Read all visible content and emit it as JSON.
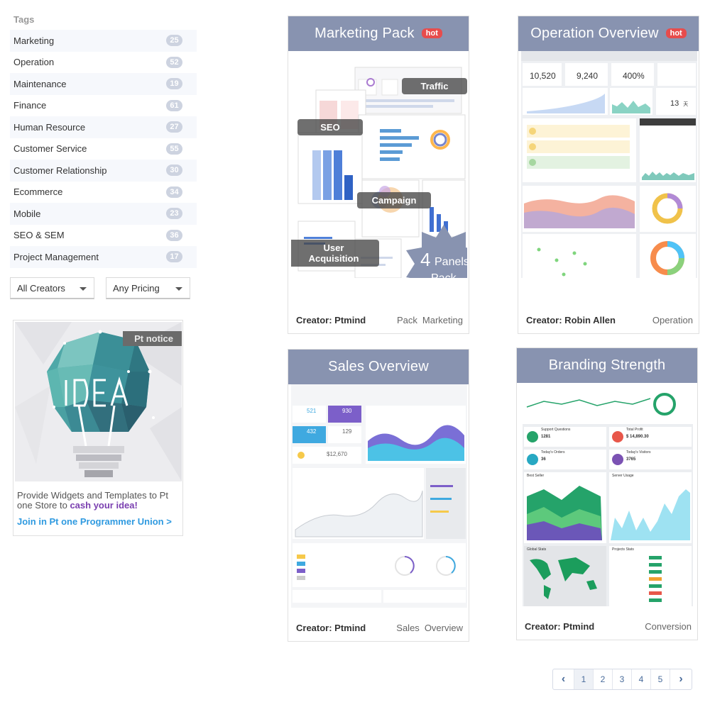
{
  "sidebar": {
    "heading": "Tags",
    "tags": [
      {
        "label": "Marketing",
        "count": "25"
      },
      {
        "label": "Operation",
        "count": "52"
      },
      {
        "label": "Maintenance",
        "count": "19"
      },
      {
        "label": "Finance",
        "count": "61"
      },
      {
        "label": "Human Resource",
        "count": "27"
      },
      {
        "label": "Customer Service",
        "count": "55"
      },
      {
        "label": "Customer Relationship",
        "count": "30"
      },
      {
        "label": "Ecommerce",
        "count": "34"
      },
      {
        "label": "Mobile",
        "count": "23"
      },
      {
        "label": "SEO & SEM",
        "count": "36"
      },
      {
        "label": "Project Management",
        "count": "17"
      }
    ],
    "filters": {
      "creators": "All Creators",
      "pricing": "Any Pricing"
    },
    "notice": {
      "badge": "Pt notice",
      "image_text": "IDEA",
      "text_before": "Provide Widgets and Templates to Pt one Store to ",
      "text_highlight": "cash your idea!",
      "link": "Join in Pt one Programmer Union >"
    }
  },
  "cards": [
    {
      "title": "Marketing Pack",
      "badge": "hot",
      "creator": "Creator: Ptmind",
      "tags": [
        "Pack",
        "Marketing"
      ],
      "overlays": [
        "Traffic",
        "SEO",
        "Campaign",
        "User Acquisition"
      ],
      "pack_number": "4",
      "pack_word": "Panels",
      "pack_label": "Pack"
    },
    {
      "title": "Operation Overview",
      "badge": "hot",
      "creator": "Creator: Robin Allen",
      "tags": [
        "Operation"
      ],
      "stats": [
        "10,520",
        "9,240",
        "400%",
        "13"
      ],
      "stat_unit": "天"
    },
    {
      "title": "Sales Overview",
      "creator": "Creator: Ptmind",
      "tags": [
        "Sales",
        "Overview"
      ],
      "stats": [
        "521",
        "930",
        "432",
        "129",
        "$12,670"
      ]
    },
    {
      "title": "Branding Strength",
      "creator": "Creator: Ptmind",
      "tags": [
        "Conversion"
      ],
      "stats": [
        "Support Questions",
        "1281",
        "Total Profit",
        "$ 14,890.30",
        "Today's Orders",
        "36",
        "Today's Visitors",
        "3765"
      ],
      "panels": [
        "Best Seller",
        "Server Usage",
        "Global Stats",
        "Projects Stats"
      ]
    }
  ],
  "pagination": {
    "prev": "‹",
    "pages": [
      "1",
      "2",
      "3",
      "4",
      "5"
    ],
    "next": "›",
    "active": "1"
  },
  "colors": {
    "card_header": "#8893b0",
    "hot": "#e74c4c",
    "tag_badge": "#cdd3e0",
    "link": "#2f9ae0",
    "highlight": "#7a3fb0"
  }
}
